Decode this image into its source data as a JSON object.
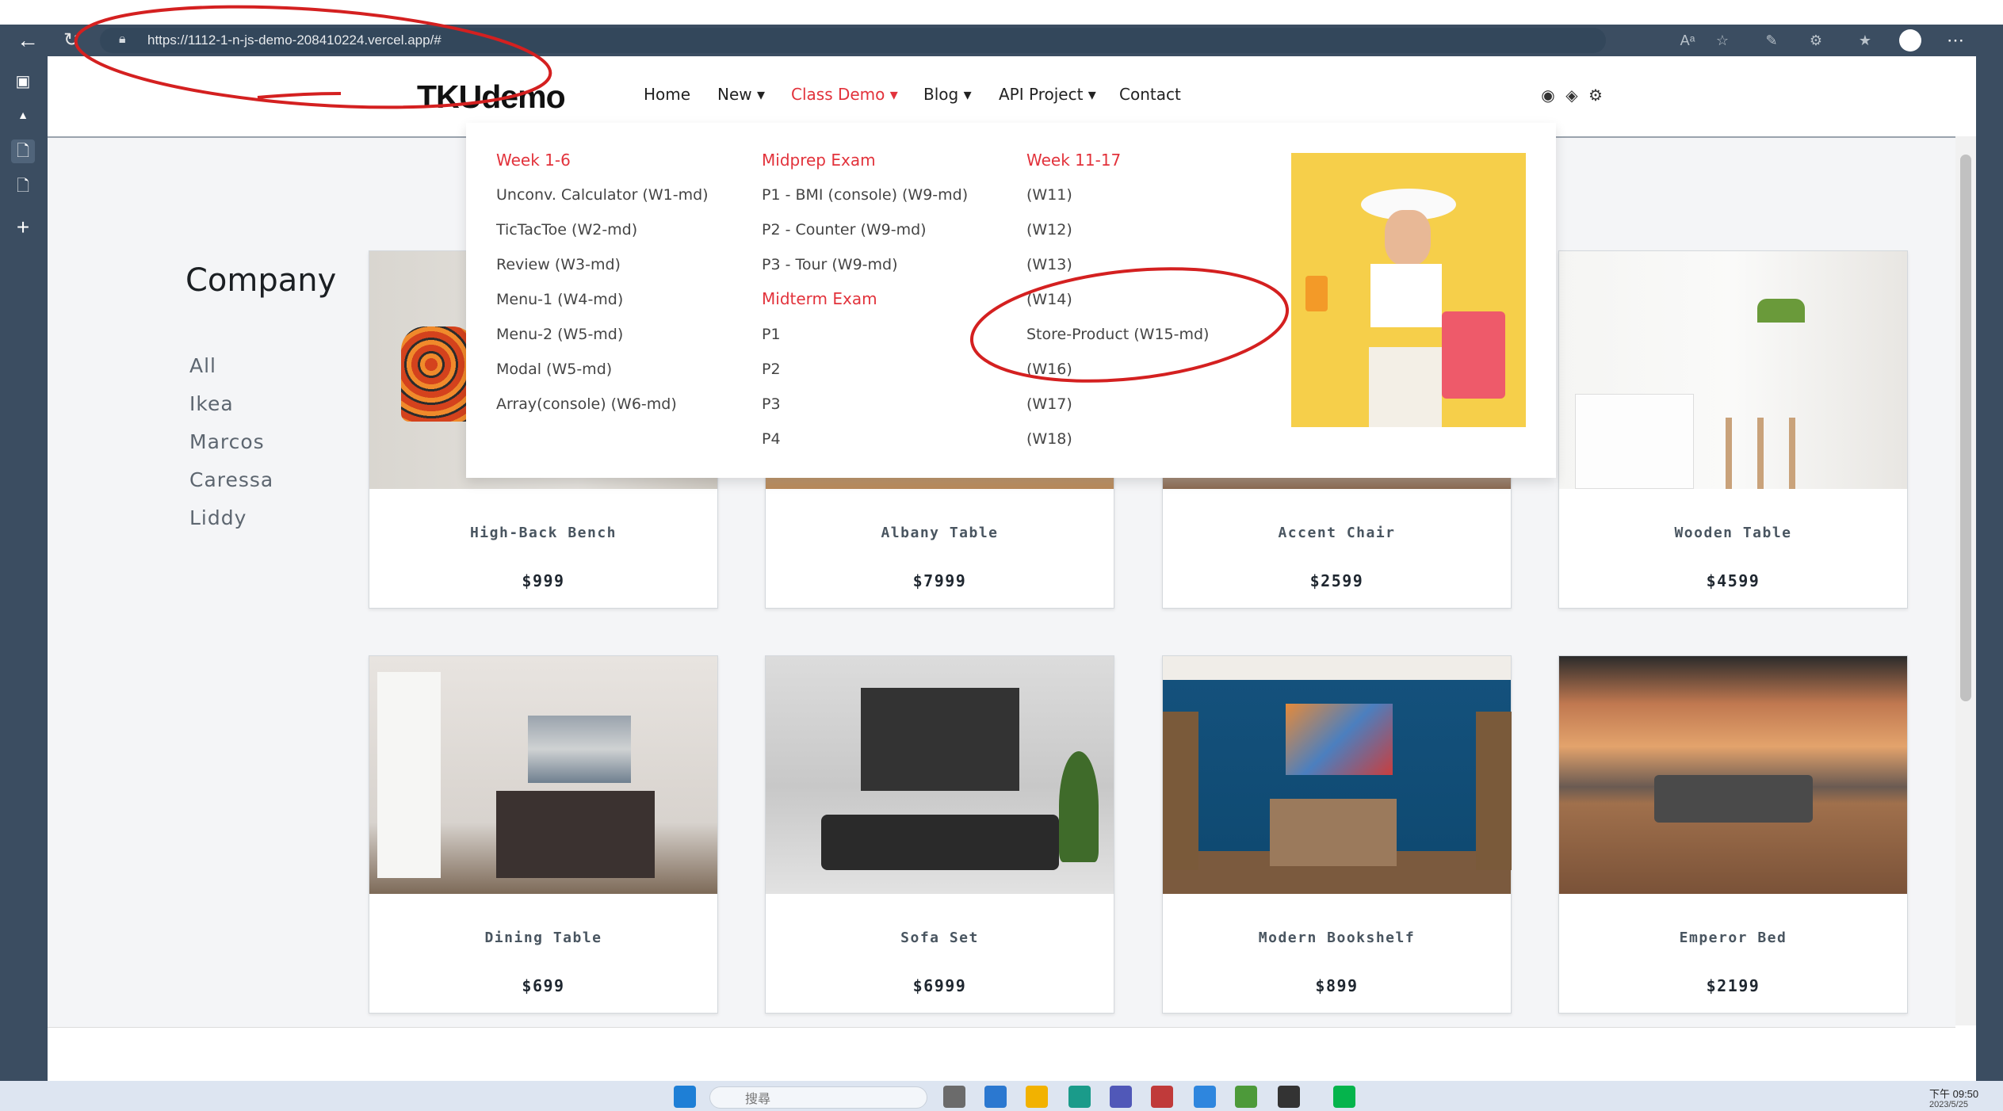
{
  "browser": {
    "url": "https://1112-1-n-js-demo-208410224.vercel.app/#"
  },
  "site": {
    "logo": "TKUdemo",
    "nav": [
      {
        "label": "Home"
      },
      {
        "label": "New ▾"
      },
      {
        "label": "Class Demo ▾",
        "active": true
      },
      {
        "label": "Blog ▾"
      },
      {
        "label": "API Project ▾"
      },
      {
        "label": "Contact"
      }
    ],
    "nav_icons": [
      "github-icon",
      "diamond-icon",
      "gear-icon"
    ]
  },
  "mega_menu": {
    "col1": {
      "heading": "Week 1-6",
      "items": [
        "Unconv. Calculator (W1-md)",
        "TicTacToe (W2-md)",
        "Review (W3-md)",
        "Menu-1 (W4-md)",
        "Menu-2 (W5-md)",
        "Modal (W5-md)",
        "Array(console) (W6-md)"
      ]
    },
    "col2": {
      "heading": "Midprep Exam",
      "items": [
        "P1 - BMI (console) (W9-md)",
        "P2 - Counter (W9-md)",
        "P3 - Tour (W9-md)"
      ],
      "heading2": "Midterm Exam",
      "items2": [
        "P1",
        "P2",
        "P3",
        "P4"
      ]
    },
    "col3": {
      "heading": "Week 11-17",
      "items": [
        "(W11)",
        "(W12)",
        "(W13)",
        "(W14)",
        "Store-Product (W15-md)",
        "(W16)",
        "(W17)",
        "(W18)"
      ]
    }
  },
  "sidebar": {
    "title": "Company",
    "companies": [
      "All",
      "Ikea",
      "Marcos",
      "Caressa",
      "Liddy"
    ]
  },
  "products": [
    {
      "name": "High-Back Bench",
      "price": "$999"
    },
    {
      "name": "Albany Table",
      "price": "$7999"
    },
    {
      "name": "Accent Chair",
      "price": "$2599"
    },
    {
      "name": "Wooden Table",
      "price": "$4599"
    },
    {
      "name": "Dining Table",
      "price": "$699"
    },
    {
      "name": "Sofa Set",
      "price": "$6999"
    },
    {
      "name": "Modern Bookshelf",
      "price": "$899"
    },
    {
      "name": "Emperor Bed",
      "price": "$2199"
    }
  ],
  "taskbar": {
    "search_placeholder": "搜尋",
    "time": "下午 09:50",
    "date": "2023/5/25"
  },
  "colors": {
    "accent": "#e2323b",
    "chrome": "#3b4d61",
    "annotation": "#d42020"
  }
}
